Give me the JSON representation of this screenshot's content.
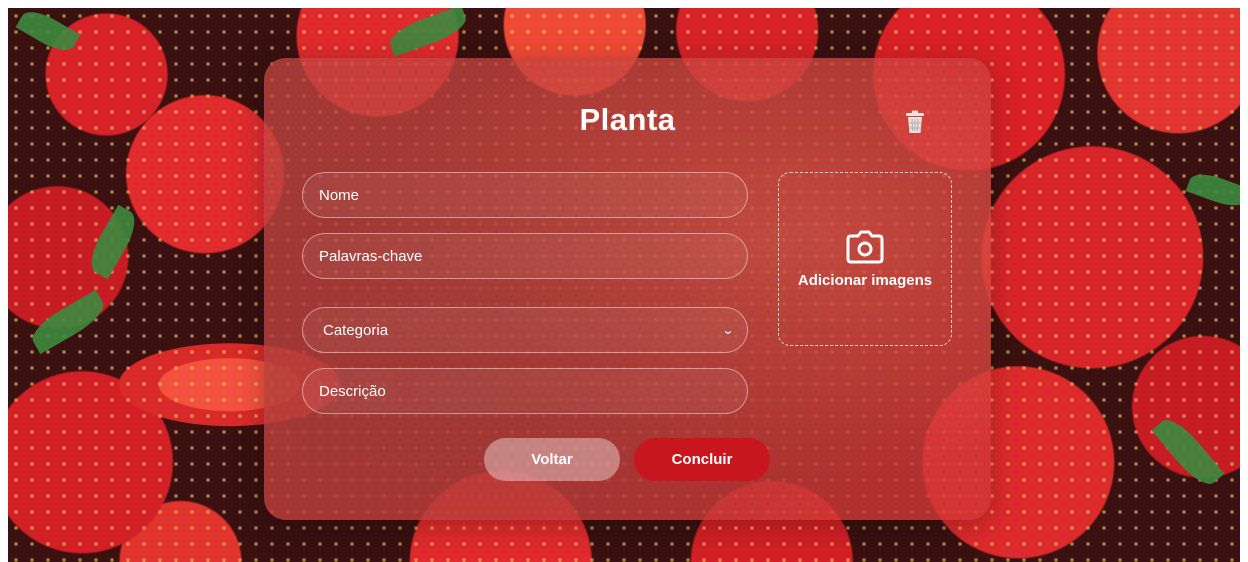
{
  "form": {
    "title": "Planta",
    "fields": {
      "name_placeholder": "Nome",
      "keywords_placeholder": "Palavras-chave",
      "category_selected": "Categoria",
      "description_placeholder": "Descrição"
    },
    "upload": {
      "label": "Adicionar imagens",
      "icon": "camera-icon"
    },
    "delete_icon": "trash-icon",
    "buttons": {
      "back": "Voltar",
      "submit": "Concluir"
    }
  },
  "colors": {
    "primary_button": "#c8161f",
    "card_tint": "#c84444",
    "text": "#ffffff"
  }
}
